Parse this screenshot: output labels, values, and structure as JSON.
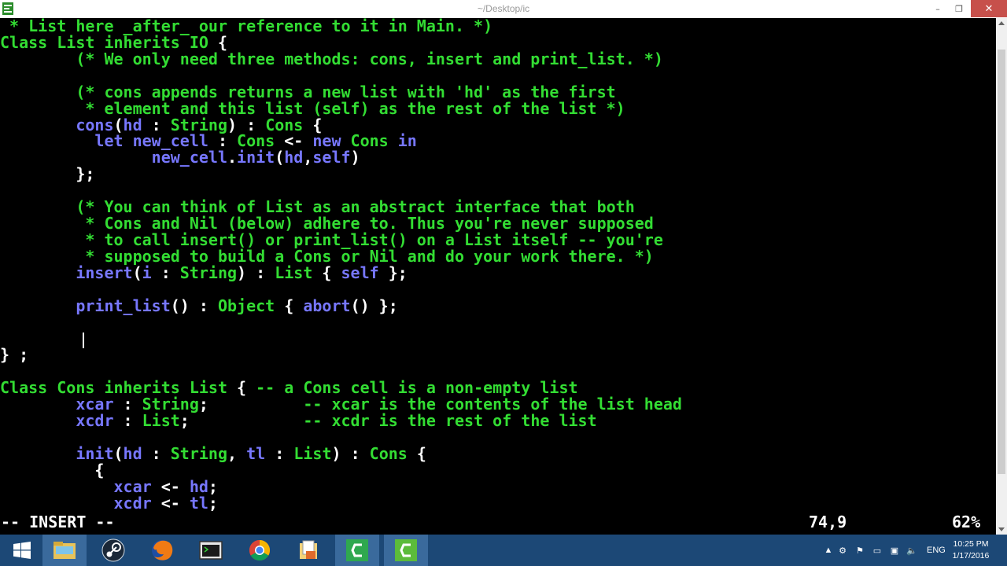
{
  "window": {
    "title": "~/Desktop/ic",
    "minimize_label": "–",
    "maximize_label": "❐",
    "close_label": "✕"
  },
  "editor": {
    "lines": [
      [
        {
          "t": " * List here _after_ our reference to it in Main. *)",
          "c": "c"
        }
      ],
      [
        {
          "t": "Class ",
          "c": "k"
        },
        {
          "t": "List ",
          "c": "t"
        },
        {
          "t": "inherits ",
          "c": "k"
        },
        {
          "t": "IO",
          "c": "t"
        },
        {
          "t": " {",
          "c": "w"
        }
      ],
      [
        {
          "t": "        (* We only need three methods: cons, insert and print_list. *)",
          "c": "c"
        }
      ],
      [
        {
          "t": "",
          "c": "w"
        }
      ],
      [
        {
          "t": "        (* cons appends returns a new list with 'hd' as the first",
          "c": "c"
        }
      ],
      [
        {
          "t": "         * element and this list (self) as the rest of the list *)",
          "c": "c"
        }
      ],
      [
        {
          "t": "        cons",
          "c": "b"
        },
        {
          "t": "(",
          "c": "w"
        },
        {
          "t": "hd",
          "c": "b"
        },
        {
          "t": " : ",
          "c": "w"
        },
        {
          "t": "String",
          "c": "t"
        },
        {
          "t": ") : ",
          "c": "w"
        },
        {
          "t": "Cons",
          "c": "t"
        },
        {
          "t": " {",
          "c": "w"
        }
      ],
      [
        {
          "t": "          let ",
          "c": "b"
        },
        {
          "t": "new_cell",
          "c": "b"
        },
        {
          "t": " : ",
          "c": "w"
        },
        {
          "t": "Cons",
          "c": "t"
        },
        {
          "t": " <- ",
          "c": "w"
        },
        {
          "t": "new ",
          "c": "b"
        },
        {
          "t": "Cons ",
          "c": "t"
        },
        {
          "t": "in",
          "c": "b"
        }
      ],
      [
        {
          "t": "                new_cell",
          "c": "b"
        },
        {
          "t": ".",
          "c": "w"
        },
        {
          "t": "init",
          "c": "b"
        },
        {
          "t": "(",
          "c": "w"
        },
        {
          "t": "hd",
          "c": "b"
        },
        {
          "t": ",",
          "c": "w"
        },
        {
          "t": "self",
          "c": "b"
        },
        {
          "t": ")",
          "c": "w"
        }
      ],
      [
        {
          "t": "        };",
          "c": "w"
        }
      ],
      [
        {
          "t": "",
          "c": "w"
        }
      ],
      [
        {
          "t": "        (* You can think of List as an abstract interface that both",
          "c": "c"
        }
      ],
      [
        {
          "t": "         * Cons and Nil (below) adhere to. Thus you're never supposed",
          "c": "c"
        }
      ],
      [
        {
          "t": "         * to call insert() or print_list() on a List itself -- you're",
          "c": "c"
        }
      ],
      [
        {
          "t": "         * supposed to build a Cons or Nil and do your work there. *)",
          "c": "c"
        }
      ],
      [
        {
          "t": "        insert",
          "c": "b"
        },
        {
          "t": "(",
          "c": "w"
        },
        {
          "t": "i",
          "c": "b"
        },
        {
          "t": " : ",
          "c": "w"
        },
        {
          "t": "String",
          "c": "t"
        },
        {
          "t": ") : ",
          "c": "w"
        },
        {
          "t": "List",
          "c": "t"
        },
        {
          "t": " { ",
          "c": "w"
        },
        {
          "t": "self",
          "c": "b"
        },
        {
          "t": " };",
          "c": "w"
        }
      ],
      [
        {
          "t": "",
          "c": "w"
        }
      ],
      [
        {
          "t": "        print_list",
          "c": "b"
        },
        {
          "t": "() : ",
          "c": "w"
        },
        {
          "t": "Object",
          "c": "t"
        },
        {
          "t": " { ",
          "c": "w"
        },
        {
          "t": "abort",
          "c": "b"
        },
        {
          "t": "() };",
          "c": "w"
        }
      ],
      [
        {
          "t": "",
          "c": "w"
        }
      ],
      [
        {
          "t": "",
          "c": "w"
        }
      ],
      [
        {
          "t": "} ;",
          "c": "w"
        }
      ],
      [
        {
          "t": "",
          "c": "w"
        }
      ],
      [
        {
          "t": "Class ",
          "c": "k"
        },
        {
          "t": "Cons ",
          "c": "t"
        },
        {
          "t": "inherits ",
          "c": "k"
        },
        {
          "t": "List",
          "c": "t"
        },
        {
          "t": " { ",
          "c": "w"
        },
        {
          "t": "-- a Cons cell is a non-empty list",
          "c": "c"
        }
      ],
      [
        {
          "t": "        xcar",
          "c": "b"
        },
        {
          "t": " : ",
          "c": "w"
        },
        {
          "t": "String",
          "c": "t"
        },
        {
          "t": ";          ",
          "c": "w"
        },
        {
          "t": "-- xcar is the contents of the list head",
          "c": "c"
        }
      ],
      [
        {
          "t": "        xcdr",
          "c": "b"
        },
        {
          "t": " : ",
          "c": "w"
        },
        {
          "t": "List",
          "c": "t"
        },
        {
          "t": ";            ",
          "c": "w"
        },
        {
          "t": "-- xcdr is the rest of the list",
          "c": "c"
        }
      ],
      [
        {
          "t": "",
          "c": "w"
        }
      ],
      [
        {
          "t": "        init",
          "c": "b"
        },
        {
          "t": "(",
          "c": "w"
        },
        {
          "t": "hd",
          "c": "b"
        },
        {
          "t": " : ",
          "c": "w"
        },
        {
          "t": "String",
          "c": "t"
        },
        {
          "t": ", ",
          "c": "w"
        },
        {
          "t": "tl",
          "c": "b"
        },
        {
          "t": " : ",
          "c": "w"
        },
        {
          "t": "List",
          "c": "t"
        },
        {
          "t": ") : ",
          "c": "w"
        },
        {
          "t": "Cons",
          "c": "t"
        },
        {
          "t": " {",
          "c": "w"
        }
      ],
      [
        {
          "t": "          {",
          "c": "w"
        }
      ],
      [
        {
          "t": "            xcar",
          "c": "b"
        },
        {
          "t": " <- ",
          "c": "w"
        },
        {
          "t": "hd",
          "c": "b"
        },
        {
          "t": ";",
          "c": "w"
        }
      ],
      [
        {
          "t": "            xcdr",
          "c": "b"
        },
        {
          "t": " <- ",
          "c": "w"
        },
        {
          "t": "tl",
          "c": "b"
        },
        {
          "t": ";",
          "c": "w"
        }
      ]
    ]
  },
  "status": {
    "mode": "-- INSERT --",
    "position": "74,9",
    "percent": "62%"
  },
  "taskbar": {
    "items": [
      {
        "name": "start-button",
        "icon": "windows-logo-icon"
      },
      {
        "name": "file-explorer",
        "icon": "folder-icon"
      },
      {
        "name": "steam",
        "icon": "steam-icon"
      },
      {
        "name": "firefox",
        "icon": "firefox-icon"
      },
      {
        "name": "terminal",
        "icon": "terminal-icon"
      },
      {
        "name": "chrome",
        "icon": "chrome-icon"
      },
      {
        "name": "file-manager",
        "icon": "document-folder-icon"
      },
      {
        "name": "camtasia-1",
        "icon": "camtasia-icon"
      },
      {
        "name": "camtasia-2",
        "icon": "camtasia-icon"
      }
    ],
    "tray": {
      "language": "ENG",
      "time": "10:25 PM",
      "date": "1/17/2016"
    }
  },
  "colors": {
    "comment": "#33dd33",
    "keyword": "#33dd33",
    "identifier": "#7777ff",
    "punctuation": "#ffffff",
    "taskbar": "#1c4876"
  }
}
